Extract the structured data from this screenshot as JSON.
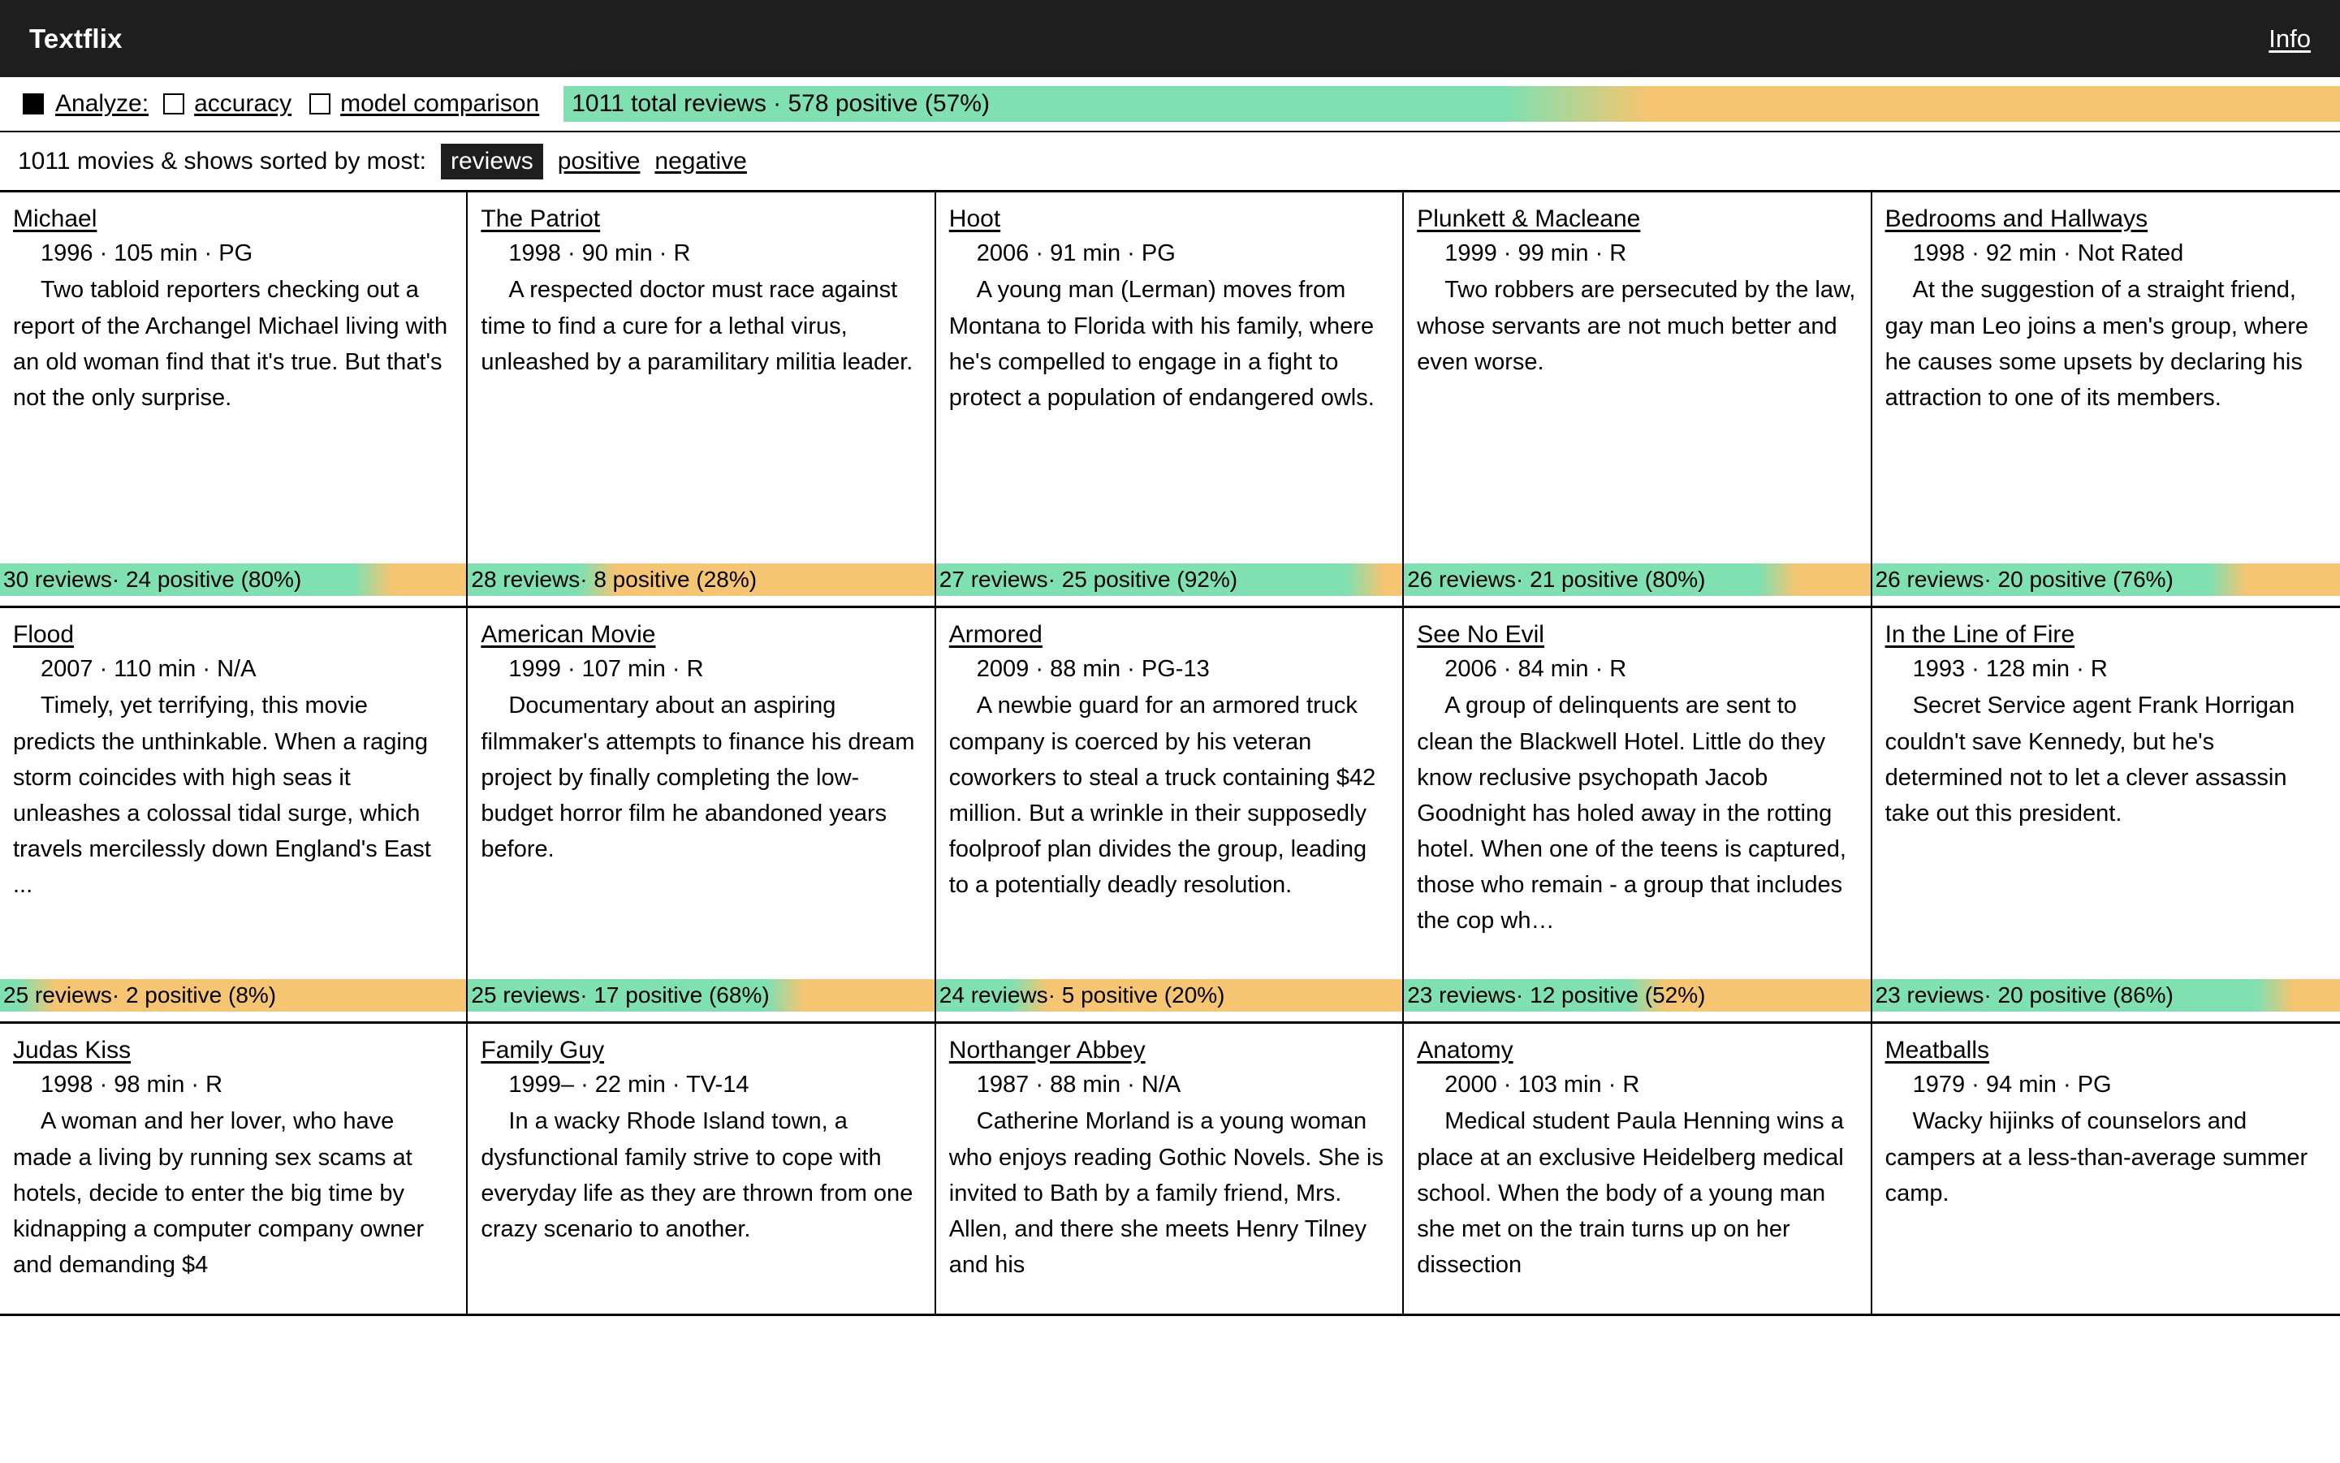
{
  "header": {
    "brand": "Textflix",
    "info_link": "Info"
  },
  "analyze": {
    "label": "Analyze:",
    "options": [
      {
        "label": "accuracy",
        "checked": false
      },
      {
        "label": "model comparison",
        "checked": false
      }
    ],
    "main_checked": true,
    "summary": "1011 total reviews · 578 positive (57%)",
    "summary_positive_pct": 57
  },
  "sort": {
    "prefix": "1011 movies & shows sorted by most:",
    "options": [
      "reviews",
      "positive",
      "negative"
    ],
    "active": "reviews"
  },
  "colors": {
    "positive": "#7fe0b2",
    "negative": "#f5c571",
    "header_bg": "#1e1e1e",
    "text": "#000000"
  },
  "cards": [
    {
      "title": "Michael",
      "meta": "1996 · 105 min · PG",
      "desc": "Two tabloid reporters checking out a report of the Archangel Michael living with an old woman find that it's true. But that's not the only surprise.",
      "reviews": 30,
      "positive": 24,
      "pct": 80,
      "bar_text": "30 reviews· 24 positive (80%)"
    },
    {
      "title": "The Patriot",
      "meta": "1998 · 90 min · R",
      "desc": "A respected doctor must race against time to find a cure for a lethal virus, unleashed by a paramilitary militia leader.",
      "reviews": 28,
      "positive": 8,
      "pct": 28,
      "bar_text": "28 reviews· 8 positive (28%)"
    },
    {
      "title": "Hoot",
      "meta": "2006 · 91 min · PG",
      "desc": "A young man (Lerman) moves from Montana to Florida with his family, where he's compelled to engage in a fight to protect a population of endangered owls.",
      "reviews": 27,
      "positive": 25,
      "pct": 92,
      "bar_text": "27 reviews· 25 positive (92%)"
    },
    {
      "title": "Plunkett & Macleane",
      "meta": "1999 · 99 min · R",
      "desc": "Two robbers are persecuted by the law, whose servants are not much better and even worse.",
      "reviews": 26,
      "positive": 21,
      "pct": 80,
      "bar_text": "26 reviews· 21 positive (80%)"
    },
    {
      "title": "Bedrooms and Hallways",
      "meta": "1998 · 92 min · Not Rated",
      "desc": "At the suggestion of a straight friend, gay man Leo joins a men's group, where he causes some upsets by declaring his attraction to one of its members.",
      "reviews": 26,
      "positive": 20,
      "pct": 76,
      "bar_text": "26 reviews· 20 positive (76%)"
    },
    {
      "title": "Flood",
      "meta": "2007 · 110 min · N/A",
      "desc": "Timely, yet terrifying, this movie predicts the unthinkable. When a raging storm coincides with high seas it unleashes a colossal tidal surge, which travels mercilessly down England's East ...",
      "reviews": 25,
      "positive": 2,
      "pct": 8,
      "bar_text": "25 reviews· 2 positive (8%)"
    },
    {
      "title": "American Movie",
      "meta": "1999 · 107 min · R",
      "desc": "Documentary about an aspiring filmmaker's attempts to finance his dream project by finally completing the low-budget horror film he abandoned years before.",
      "reviews": 25,
      "positive": 17,
      "pct": 68,
      "bar_text": "25 reviews· 17 positive (68%)"
    },
    {
      "title": "Armored",
      "meta": "2009 · 88 min · PG-13",
      "desc": "A newbie guard for an armored truck company is coerced by his veteran coworkers to steal a truck containing $42 million. But a wrinkle in their supposedly foolproof plan divides the group, leading to a potentially deadly resolution.",
      "reviews": 24,
      "positive": 5,
      "pct": 20,
      "bar_text": "24 reviews· 5 positive (20%)"
    },
    {
      "title": "See No Evil",
      "meta": "2006 · 84 min · R",
      "desc": "A group of delinquents are sent to clean the Blackwell Hotel. Little do they know reclusive psychopath Jacob Goodnight has holed away in the rotting hotel. When one of the teens is captured, those who remain - a group that includes the cop wh…",
      "reviews": 23,
      "positive": 12,
      "pct": 52,
      "bar_text": "23 reviews· 12 positive (52%)"
    },
    {
      "title": "In the Line of Fire",
      "meta": "1993 · 128 min · R",
      "desc": "Secret Service agent Frank Horrigan couldn't save Kennedy, but he's determined not to let a clever assassin take out this president.",
      "reviews": 23,
      "positive": 20,
      "pct": 86,
      "bar_text": "23 reviews· 20 positive (86%)"
    },
    {
      "title": "Judas Kiss",
      "meta": "1998 · 98 min · R",
      "desc": "A woman and her lover, who have made a living by running sex scams at hotels, decide to enter the big time by kidnapping a computer company owner and demanding $4",
      "reviews": null,
      "positive": null,
      "pct": null,
      "bar_text": ""
    },
    {
      "title": "Family Guy",
      "meta": "1999– · 22 min · TV-14",
      "desc": "In a wacky Rhode Island town, a dysfunctional family strive to cope with everyday life as they are thrown from one crazy scenario to another.",
      "reviews": null,
      "positive": null,
      "pct": null,
      "bar_text": ""
    },
    {
      "title": "Northanger Abbey",
      "meta": "1987 · 88 min · N/A",
      "desc": "Catherine Morland is a young woman who enjoys reading Gothic Novels. She is invited to Bath by a family friend, Mrs. Allen, and there she meets Henry Tilney and his",
      "reviews": null,
      "positive": null,
      "pct": null,
      "bar_text": ""
    },
    {
      "title": "Anatomy",
      "meta": "2000 · 103 min · R",
      "desc": "Medical student Paula Henning wins a place at an exclusive Heidelberg medical school. When the body of a young man she met on the train turns up on her dissection",
      "reviews": null,
      "positive": null,
      "pct": null,
      "bar_text": ""
    },
    {
      "title": "Meatballs",
      "meta": "1979 · 94 min · PG",
      "desc": "Wacky hijinks of counselors and campers at a less-than-average summer camp.",
      "reviews": null,
      "positive": null,
      "pct": null,
      "bar_text": ""
    }
  ]
}
